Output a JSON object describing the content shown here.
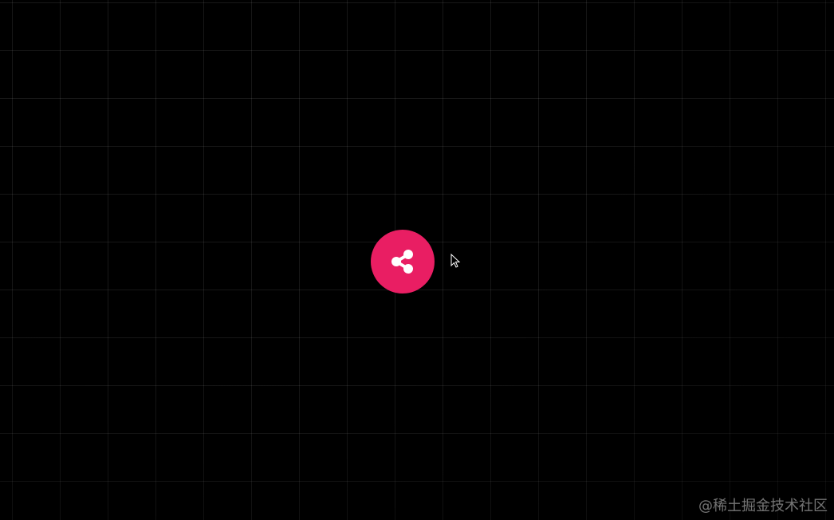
{
  "colors": {
    "background": "#000000",
    "accent": "#e91e63",
    "icon": "#ffffff"
  },
  "share_button": {
    "icon": "share-icon",
    "label": ""
  },
  "cursor": {
    "icon": "pointer-cursor-icon"
  },
  "watermark": {
    "text": "@稀土掘金技术社区"
  }
}
